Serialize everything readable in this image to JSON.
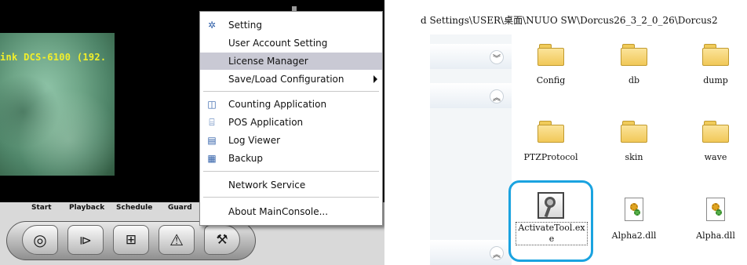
{
  "left": {
    "camera_label": "ink DCS-6100 (192.",
    "nav_labels": [
      "Start",
      "Playback",
      "Schedule",
      "Guard"
    ],
    "toolbar_buttons": [
      {
        "icon": "record-circle-icon"
      },
      {
        "icon": "playback-icon"
      },
      {
        "icon": "schedule-icon"
      },
      {
        "icon": "warning-icon"
      },
      {
        "icon": "tools-icon"
      }
    ],
    "menu": {
      "items": [
        {
          "label": "Setting",
          "icon": "gear-icon",
          "highlight": false
        },
        {
          "label": "User Account Setting",
          "icon": "",
          "highlight": false
        },
        {
          "label": "License Manager",
          "icon": "",
          "highlight": true
        },
        {
          "label": "Save/Load Configuration",
          "icon": "",
          "highlight": false,
          "submenu": true
        },
        {
          "label": "Counting Application",
          "icon": "counting-icon",
          "highlight": false
        },
        {
          "label": "POS Application",
          "icon": "pos-icon",
          "highlight": false
        },
        {
          "label": "Log Viewer",
          "icon": "log-viewer-icon",
          "highlight": false
        },
        {
          "label": "Backup",
          "icon": "backup-icon",
          "highlight": false
        },
        {
          "label": "Network Service",
          "icon": "",
          "highlight": false
        },
        {
          "label": "About MainConsole...",
          "icon": "",
          "highlight": false
        }
      ]
    }
  },
  "right": {
    "address": "d Settings\\USER\\桌面\\NUUO SW\\Dorcus26_3_2_0_26\\Dorcus2",
    "items": [
      {
        "label": "Config",
        "type": "folder"
      },
      {
        "label": "db",
        "type": "folder"
      },
      {
        "label": "dump",
        "type": "folder"
      },
      {
        "label": "PTZProtocol",
        "type": "folder"
      },
      {
        "label": "skin",
        "type": "folder"
      },
      {
        "label": "wave",
        "type": "folder"
      },
      {
        "label": "ActivateTool.exe",
        "type": "exe",
        "selected": true
      },
      {
        "label": "Alpha2.dll",
        "type": "dll"
      },
      {
        "label": "Alpha.dll",
        "type": "dll"
      }
    ],
    "colors": {
      "selection_ring": "#1aa3e0",
      "menu_highlight": "#c9c9d4"
    }
  }
}
